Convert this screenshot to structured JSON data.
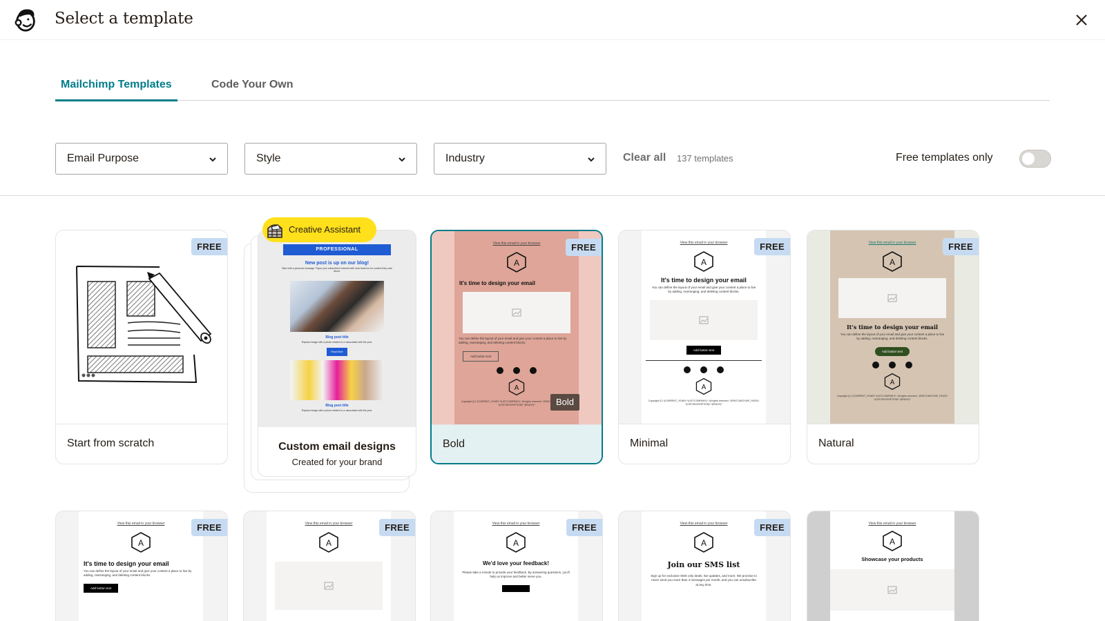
{
  "header": {
    "title": "Select a template",
    "logo_icon": "mailchimp-freddie-logo",
    "close_icon": "close-icon"
  },
  "tabs": [
    {
      "label": "Mailchimp Templates",
      "active": true
    },
    {
      "label": "Code Your Own",
      "active": false
    }
  ],
  "filters": {
    "email_purpose": "Email Purpose",
    "style": "Style",
    "industry": "Industry",
    "clear_all": "Clear all",
    "template_count": "137 templates",
    "free_only_label": "Free templates only",
    "free_only_on": false
  },
  "colors": {
    "accent": "#007c89",
    "badge_bg": "#c6dbf2",
    "creative_yellow": "#ffe01b",
    "bold_pink": "#dea598",
    "natural_beige": "#d5c4b2"
  },
  "badge_label": "FREE",
  "creative_assistant": {
    "pill": "Creative Assistant",
    "title": "Custom email designs",
    "subtitle": "Created for your brand",
    "preview": {
      "banner": "PROFESSIONAL",
      "heading": "New post is up on our blog!",
      "intro": "Start with a personal message. Pique your subscriber's interest with short lead-ins for content they care about.",
      "post_title": "Blog post title",
      "post_desc": "Replace image with a photo related to or associated with the post.",
      "read_more": "Read More"
    }
  },
  "email_preview": {
    "view_link": "View this email in your browser",
    "logo_letter": "A",
    "heading": "It's time to design your email",
    "body": "You can define the layout of your email and give your content a place to live by adding, rearranging, and deleting content blocks.",
    "button": "Add button text",
    "copyright": "Copyright (C) *|CURRENT_YEAR|* *|LIST:COMPANY|*. All rights reserved. *|IFNOT:ARCHIVE_PAGE|* *|LIST:DESCRIPTION|* *|END:IF|*"
  },
  "templates_row1": [
    {
      "name": "Start from scratch",
      "free": true
    },
    {
      "name": "Bold",
      "free": true,
      "selected": true,
      "tooltip": "Bold"
    },
    {
      "name": "Minimal",
      "free": true
    },
    {
      "name": "Natural",
      "free": true
    }
  ],
  "templates_row2": [
    {
      "heading": "It's time to design your email",
      "free": true
    },
    {
      "heading": "",
      "free": true
    },
    {
      "heading": "We'd love your feedback!",
      "body": "Please take a minute to provide your feedback. By answering questions, you'll help us improve and better serve you.",
      "free": true
    },
    {
      "heading": "Join our SMS list",
      "body": "Sign up for exclusive SMS only deals, live updates, and more. We promise to never send you more than 4 messages per month, and you can unsubscribe at any time.",
      "free": true
    },
    {
      "heading": "Showcase your products",
      "free": false
    }
  ]
}
